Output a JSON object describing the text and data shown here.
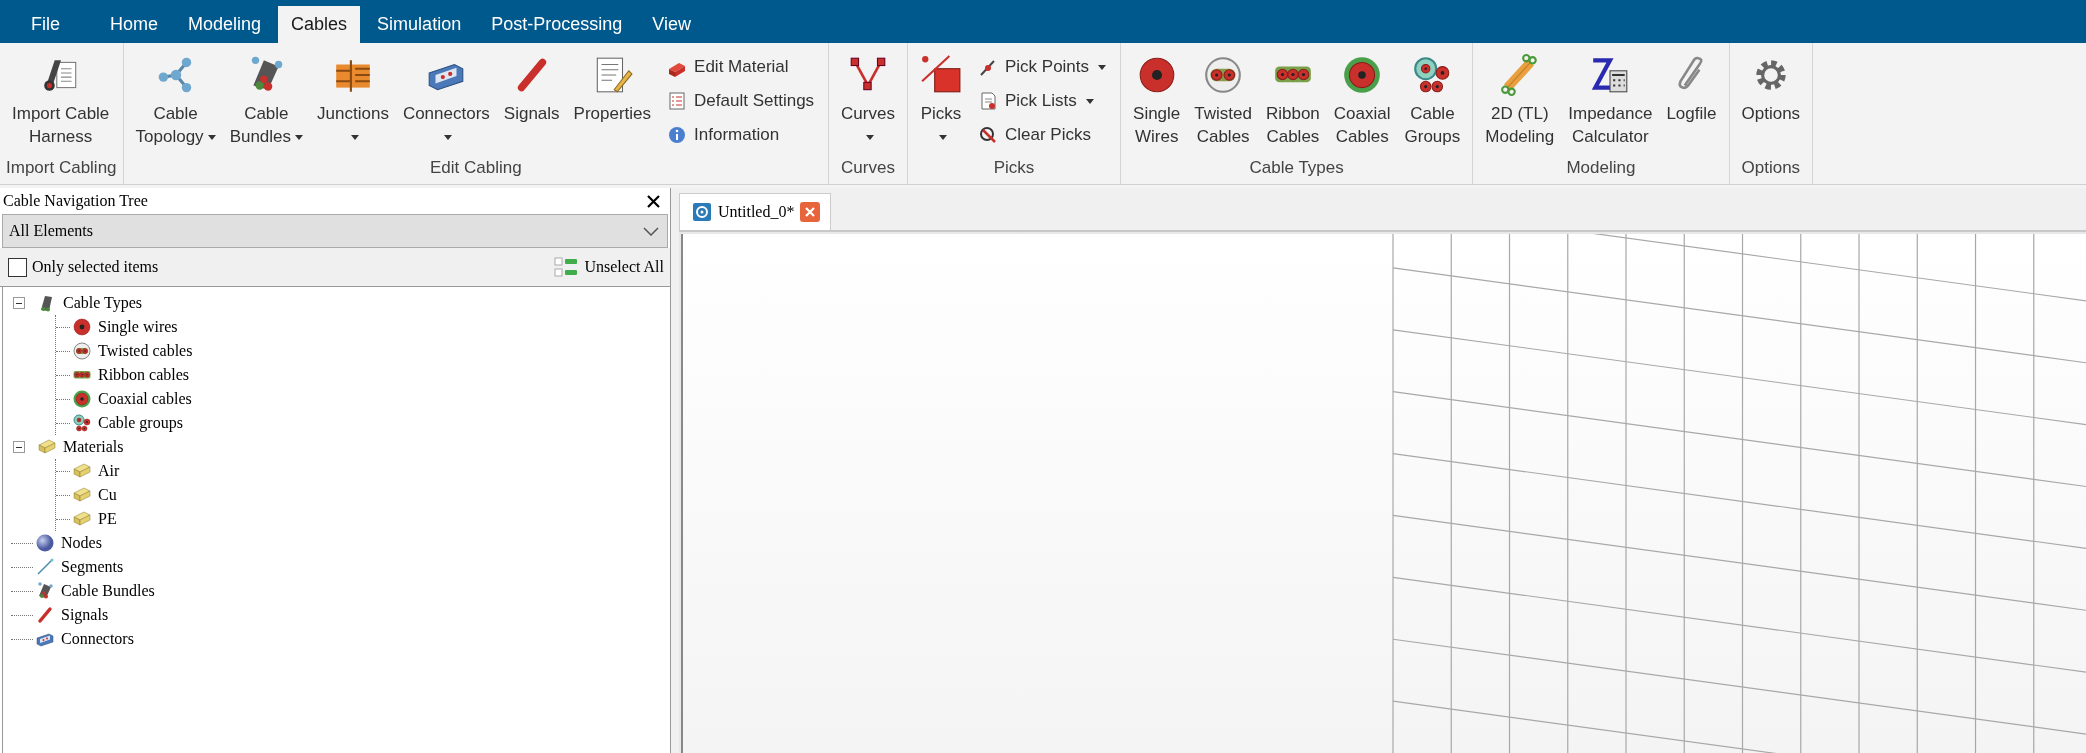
{
  "menu_tabs": [
    {
      "label": "File",
      "selected": false
    },
    {
      "label": "Home",
      "selected": false
    },
    {
      "label": "Modeling",
      "selected": false
    },
    {
      "label": "Cables",
      "selected": true
    },
    {
      "label": "Simulation",
      "selected": false
    },
    {
      "label": "Post-Processing",
      "selected": false
    },
    {
      "label": "View",
      "selected": false
    }
  ],
  "ribbon_groups": [
    {
      "title": "Import Cabling",
      "items": [
        {
          "kind": "large",
          "lines": [
            "Import Cable",
            "Harness"
          ],
          "dropdown": false
        }
      ]
    },
    {
      "title": "Edit Cabling",
      "items": [
        {
          "kind": "large",
          "lines": [
            "Cable",
            "Topology"
          ],
          "dropdown": true
        },
        {
          "kind": "large",
          "lines": [
            "Cable",
            "Bundles"
          ],
          "dropdown": true
        },
        {
          "kind": "large",
          "lines": [
            "Junctions"
          ],
          "dropdown": true
        },
        {
          "kind": "large",
          "lines": [
            "Connectors"
          ],
          "dropdown": true
        },
        {
          "kind": "large",
          "lines": [
            "Signals"
          ],
          "dropdown": false
        },
        {
          "kind": "large",
          "lines": [
            "Properties"
          ],
          "dropdown": false
        },
        {
          "kind": "small",
          "lines": [
            "Edit Material"
          ],
          "dropdown": false
        },
        {
          "kind": "small",
          "lines": [
            "Default Settings"
          ],
          "dropdown": false
        },
        {
          "kind": "small",
          "lines": [
            "Information"
          ],
          "dropdown": false
        }
      ]
    },
    {
      "title": "Curves",
      "items": [
        {
          "kind": "large",
          "lines": [
            "Curves"
          ],
          "dropdown": true
        }
      ]
    },
    {
      "title": "Picks",
      "items": [
        {
          "kind": "large",
          "lines": [
            "Picks"
          ],
          "dropdown": true
        },
        {
          "kind": "small",
          "lines": [
            "Pick Points"
          ],
          "dropdown": true
        },
        {
          "kind": "small",
          "lines": [
            "Pick Lists"
          ],
          "dropdown": true
        },
        {
          "kind": "small",
          "lines": [
            "Clear Picks"
          ],
          "dropdown": false
        }
      ]
    },
    {
      "title": "Cable Types",
      "items": [
        {
          "kind": "large",
          "lines": [
            "Single",
            "Wires"
          ],
          "dropdown": false
        },
        {
          "kind": "large",
          "lines": [
            "Twisted",
            "Cables"
          ],
          "dropdown": false
        },
        {
          "kind": "large",
          "lines": [
            "Ribbon",
            "Cables"
          ],
          "dropdown": false
        },
        {
          "kind": "large",
          "lines": [
            "Coaxial",
            "Cables"
          ],
          "dropdown": false
        },
        {
          "kind": "large",
          "lines": [
            "Cable",
            "Groups"
          ],
          "dropdown": false
        }
      ]
    },
    {
      "title": "Modeling",
      "items": [
        {
          "kind": "large",
          "lines": [
            "2D (TL)",
            "Modeling"
          ],
          "dropdown": false
        },
        {
          "kind": "large",
          "lines": [
            "Impedance",
            "Calculator"
          ],
          "dropdown": false
        },
        {
          "kind": "large",
          "lines": [
            "Logfile"
          ],
          "dropdown": false
        }
      ]
    },
    {
      "title": "Options",
      "items": [
        {
          "kind": "large",
          "lines": [
            "Options"
          ],
          "dropdown": false
        }
      ]
    }
  ],
  "navigation_panel": {
    "title": "Cable Navigation Tree",
    "filter": "All Elements",
    "only_selected_items": {
      "label": "Only selected items",
      "checked": false
    },
    "unselect_all": "Unselect All",
    "tree": [
      {
        "label": "Cable Types",
        "expanded": true,
        "children": [
          {
            "label": "Single wires"
          },
          {
            "label": "Twisted cables"
          },
          {
            "label": "Ribbon cables"
          },
          {
            "label": "Coaxial cables"
          },
          {
            "label": "Cable groups"
          }
        ]
      },
      {
        "label": "Materials",
        "expanded": true,
        "children": [
          {
            "label": "Air"
          },
          {
            "label": "Cu"
          },
          {
            "label": "PE"
          }
        ]
      },
      {
        "label": "Nodes"
      },
      {
        "label": "Segments"
      },
      {
        "label": "Cable Bundles"
      },
      {
        "label": "Signals"
      },
      {
        "label": "Connectors"
      }
    ]
  },
  "document_tab": {
    "title": "Untitled_0*"
  }
}
